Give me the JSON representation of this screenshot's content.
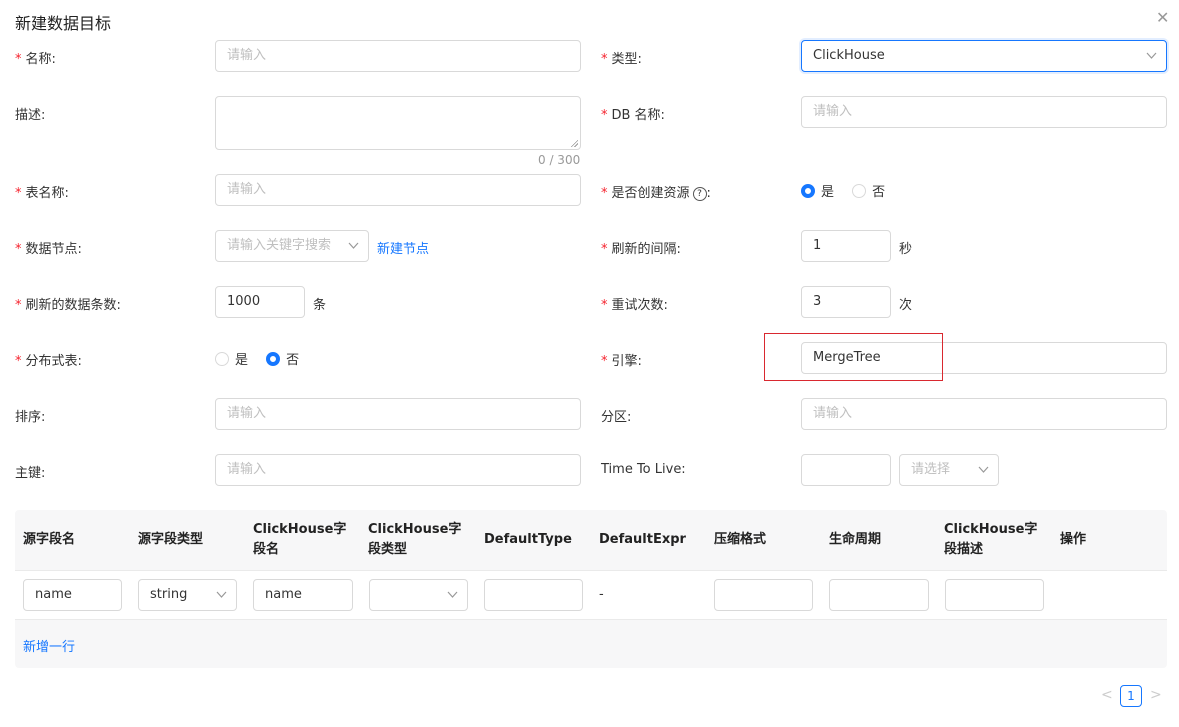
{
  "dialog": {
    "title": "新建数据目标"
  },
  "form": {
    "name": {
      "label": "名称:",
      "placeholder": "请输入"
    },
    "type": {
      "label": "类型:",
      "value": "ClickHouse"
    },
    "description": {
      "label": "描述:",
      "counter": "0 / 300"
    },
    "db_name": {
      "label": "DB 名称:",
      "placeholder": "请输入"
    },
    "table_name": {
      "label": "表名称:",
      "placeholder": "请输入"
    },
    "create_resource": {
      "label": "是否创建资源",
      "colon": ":",
      "help_glyph": "?",
      "options": [
        "是",
        "否"
      ],
      "selected": "是"
    },
    "data_node": {
      "label": "数据节点:",
      "placeholder": "请输入关键字搜索",
      "new_link": "新建节点"
    },
    "refresh_interval": {
      "label": "刷新的间隔:",
      "value": "1",
      "unit": "秒"
    },
    "refresh_rows": {
      "label": "刷新的数据条数:",
      "value": "1000",
      "unit": "条"
    },
    "retry_count": {
      "label": "重试次数:",
      "value": "3",
      "unit": "次"
    },
    "distributed": {
      "label": "分布式表:",
      "options": [
        "是",
        "否"
      ],
      "selected": "否"
    },
    "engine": {
      "label": "引擎:",
      "value": "MergeTree"
    },
    "order_by": {
      "label": "排序:",
      "placeholder": "请输入"
    },
    "partition": {
      "label": "分区:",
      "placeholder": "请输入"
    },
    "primary_key": {
      "label": "主键:",
      "placeholder": "请输入"
    },
    "ttl": {
      "label": "Time To Live:",
      "unit_placeholder": "请选择"
    }
  },
  "table": {
    "headers": [
      "源字段名",
      "源字段类型",
      "ClickHouse字段名",
      "ClickHouse字段类型",
      "DefaultType",
      "DefaultExpr",
      "压缩格式",
      "生命周期",
      "ClickHouse字段描述",
      "操作"
    ],
    "rows": [
      {
        "source_name": "name",
        "source_type": "string",
        "ch_name": "name",
        "ch_type": "",
        "default_type": "",
        "default_expr": "-",
        "compression": "",
        "lifecycle": "",
        "description": ""
      }
    ],
    "add_row": "新增一行"
  },
  "pagination": {
    "current": "1",
    "prev": "<",
    "next": ">"
  },
  "colors": {
    "accent": "#1677ff",
    "required": "#f5222d",
    "highlight": "#d9282f"
  }
}
